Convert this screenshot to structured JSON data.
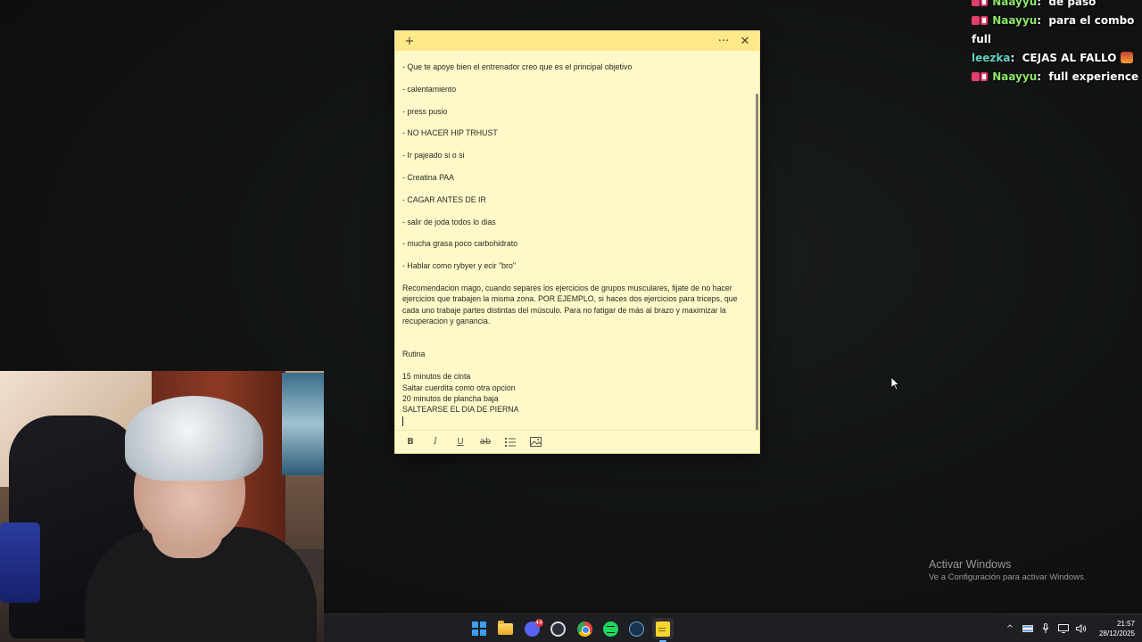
{
  "chat": {
    "messages": [
      {
        "user": "Naayyu",
        "user_color": "#8ee86a",
        "badges": [
          "pen",
          "mod"
        ],
        "text": "de paso"
      },
      {
        "user": "Naayyu",
        "user_color": "#8ee86a",
        "badges": [
          "pen",
          "mod"
        ],
        "text": "para el combo full"
      },
      {
        "user": "leezka",
        "user_color": "#5fd3c7",
        "badges": [],
        "text": "CEJAS AL FALLO",
        "emote": true
      },
      {
        "user": "Naayyu",
        "user_color": "#8ee86a",
        "badges": [
          "pen",
          "mod"
        ],
        "text": "full experience"
      }
    ]
  },
  "note": {
    "new_note_icon": "+",
    "menu_icon": "···",
    "close_icon": "✕",
    "lines": [
      "- Que te apoye bien el entrenador creo que es el principal objetivo",
      "- calentamiento",
      "- press pusio",
      "- NO HACER HIP TRHUST",
      "- Ir pajeado si o si",
      "- Creatina PAA",
      "- CAGAR ANTES DE IR",
      "- salir de joda todos lo dias",
      "- mucha grasa poco carbohidrato",
      "- Hablar como rybyer y ecir \"bro\""
    ],
    "recommendation": "Recomendacion mago, cuando separes los ejercicios de grupos musculares, fijate de no hacer ejercicios que trabajen la misma zona. POR EJEMPLO, si haces dos ejercicios para triceps, que cada uno trabaje partes distintas del músculo. Para no fatigar de más al brazo y maximizar la recuperacion y ganancia.",
    "routine_title": "Rutina",
    "routine": [
      "15 minutos de cinta",
      "Saltar cuerdita como otra opcion",
      "20 minutos de plancha baja",
      "SALTEARSE EL DIA DE PIERNA"
    ],
    "toolbar": {
      "bold": "B",
      "italic": "I",
      "underline": "U",
      "strike": "ab",
      "list_icon": "list-icon",
      "image_icon": "image-icon"
    }
  },
  "watermark": {
    "title": "Activar Windows",
    "subtitle": "Ve a Configuración para activar Windows."
  },
  "taskbar": {
    "apps": [
      "start-icon",
      "file-explorer-icon",
      "discord-icon",
      "obs-icon",
      "chrome-icon",
      "spotify-icon",
      "steam-icon",
      "sticky-notes-icon"
    ],
    "discord_badge": "44",
    "tray": {
      "chevron": "^",
      "time": "21:57",
      "date": "28/12/2025"
    }
  },
  "colors": {
    "note_bg": "#fff9c9",
    "note_titlebar": "#fde98a",
    "taskbar_bg": "#1d1f22"
  }
}
